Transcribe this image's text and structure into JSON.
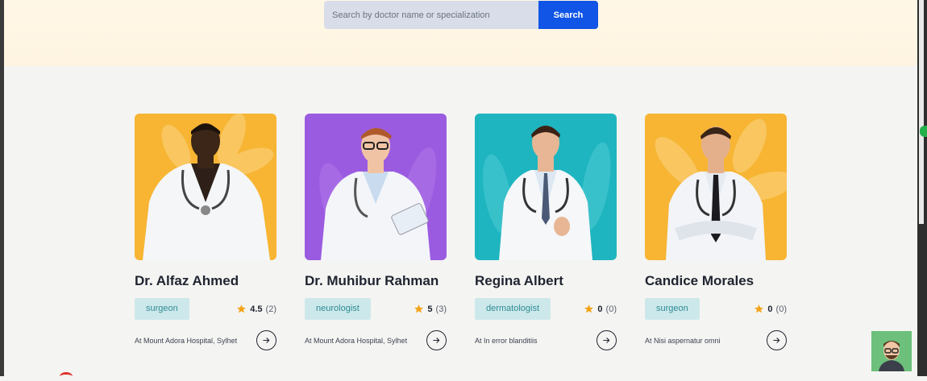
{
  "search": {
    "placeholder": "Search by doctor name or specialization",
    "button_label": "Search"
  },
  "doctors": [
    {
      "name": "Dr. Alfaz Ahmed",
      "specialization": "surgeon",
      "rating": "4.5",
      "reviews": "(2)",
      "location": "At Mount Adora Hospital, Sylhet",
      "photo_bg": "#f7b533"
    },
    {
      "name": "Dr. Muhibur Rahman",
      "specialization": "neurologist",
      "rating": "5",
      "reviews": "(3)",
      "location": "At Mount Adora Hospital, Sylhet",
      "photo_bg": "#9b5be0"
    },
    {
      "name": "Regina Albert",
      "specialization": "dermatologist",
      "rating": "0",
      "reviews": "(0)",
      "location": "At In error blanditiis",
      "photo_bg": "#1eb5c0"
    },
    {
      "name": "Candice Morales",
      "specialization": "surgeon",
      "rating": "0",
      "reviews": "(0)",
      "location": "At Nisi aspernatur omni",
      "photo_bg": "#f7b533"
    }
  ],
  "colors": {
    "accent": "#1155e6",
    "badge_bg": "#cde8ea",
    "badge_text": "#2c8c96",
    "star": "#f2a316"
  },
  "icons": [
    "star-icon",
    "arrow-right-icon",
    "doctor-photo",
    "user-avatar"
  ]
}
